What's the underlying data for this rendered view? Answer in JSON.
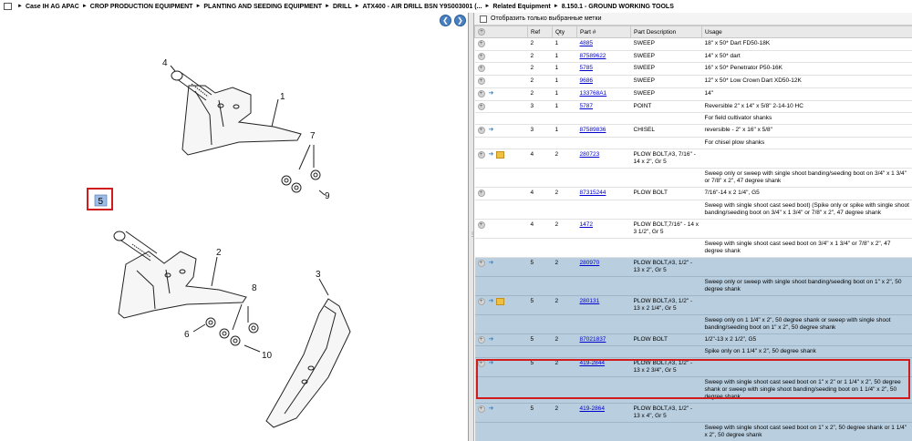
{
  "breadcrumb": [
    "Case IH AG APAC",
    "CROP PRODUCTION EQUIPMENT",
    "PLANTING AND SEEDING EQUIPMENT",
    "DRILL",
    "ATX400 - AIR DRILL BSN Y9S003001 (...",
    "Related Equipment",
    "8.150.1 - GROUND WORKING TOOLS"
  ],
  "filter_label": "Отобразить только выбранные метки",
  "columns": [
    "Ref",
    "Qty",
    "Part #",
    "Part Description",
    "Usage"
  ],
  "callouts": [
    "1",
    "2",
    "3",
    "4",
    "5",
    "6",
    "7",
    "8",
    "9",
    "10"
  ],
  "rows": [
    {
      "ref": "2",
      "qty": "1",
      "part": "4885",
      "desc": "SWEEP",
      "usage": "18\" x 50* Dart FD50-18K",
      "fish": false,
      "note": false,
      "sel": false
    },
    {
      "ref": "2",
      "qty": "1",
      "part": "87589622",
      "desc": "SWEEP",
      "usage": "14\" x 50* dart",
      "fish": false,
      "note": false,
      "sel": false
    },
    {
      "ref": "2",
      "qty": "1",
      "part": "5785",
      "desc": "SWEEP",
      "usage": "16\" x 50* Penetrator P50-16K",
      "fish": false,
      "note": false,
      "sel": false
    },
    {
      "ref": "2",
      "qty": "1",
      "part": "9686",
      "desc": "SWEEP",
      "usage": "12\" x 50* Low Crown Dart XD50-12K",
      "fish": false,
      "note": false,
      "sel": false
    },
    {
      "ref": "2",
      "qty": "1",
      "part": "133768A1",
      "desc": "SWEEP",
      "usage": "14\"",
      "fish": true,
      "note": false,
      "sel": false
    },
    {
      "ref": "3",
      "qty": "1",
      "part": "5787",
      "desc": "POINT",
      "usage": "Reversible 2\" x 14\" x 5/8\" 2-14-10 HC",
      "fish": false,
      "note": false,
      "sel": false
    },
    {
      "ref": "",
      "qty": "",
      "part": "",
      "desc": "",
      "usage": "For field cultivator shanks",
      "fish": false,
      "note": false,
      "sel": false,
      "cont": true
    },
    {
      "ref": "3",
      "qty": "1",
      "part": "87589836",
      "desc": "CHISEL",
      "usage": "reversible - 2\" x 16\" x 5/8\"",
      "fish": true,
      "note": false,
      "sel": false
    },
    {
      "ref": "",
      "qty": "",
      "part": "",
      "desc": "",
      "usage": "For chisel plow shanks",
      "fish": false,
      "note": false,
      "sel": false,
      "cont": true
    },
    {
      "ref": "4",
      "qty": "2",
      "part": "280723",
      "desc": "PLOW BOLT,#3, 7/16\" - 14 x 2\", Gr 5",
      "usage": "",
      "fish": true,
      "note": true,
      "sel": false
    },
    {
      "ref": "",
      "qty": "",
      "part": "",
      "desc": "",
      "usage": "Sweep only or sweep with single shoot banding/seeding boot on 3/4\" x 1 3/4\" or 7/8\" x 2\", 47 degree shank",
      "fish": false,
      "note": false,
      "sel": false,
      "cont": true
    },
    {
      "ref": "4",
      "qty": "2",
      "part": "87315244",
      "desc": "PLOW BOLT",
      "usage": "7/16\"-14 x 2 1/4\", G5",
      "fish": false,
      "note": false,
      "sel": false
    },
    {
      "ref": "",
      "qty": "",
      "part": "",
      "desc": "",
      "usage": "Sweep with single shoot cast seed boot) (Spike only or spike with single shoot banding/seeding boot on 3/4\" x 1 3/4\" or 7/8\" x 2\", 47 degree shank",
      "fish": false,
      "note": false,
      "sel": false,
      "cont": true
    },
    {
      "ref": "4",
      "qty": "2",
      "part": "1472",
      "desc": "PLOW BOLT,7/16\" - 14 x 3 1/2\", Gr 5",
      "usage": "",
      "fish": false,
      "note": false,
      "sel": false
    },
    {
      "ref": "",
      "qty": "",
      "part": "",
      "desc": "",
      "usage": "Sweep with single shoot cast seed boot on 3/4\" x 1 3/4\" or 7/8\" x 2\", 47 degree shank",
      "fish": false,
      "note": false,
      "sel": false,
      "cont": true
    },
    {
      "ref": "5",
      "qty": "2",
      "part": "280970",
      "desc": "PLOW BOLT,#3, 1/2\" - 13 x 2\", Gr 5",
      "usage": "",
      "fish": true,
      "note": false,
      "sel": true
    },
    {
      "ref": "",
      "qty": "",
      "part": "",
      "desc": "",
      "usage": "Sweep only or sweep with single shoot banding/seeding boot on 1\" x 2\", 50 degree shank",
      "fish": false,
      "note": false,
      "sel": true,
      "cont": true
    },
    {
      "ref": "5",
      "qty": "2",
      "part": "280131",
      "desc": "PLOW BOLT,#3, 1/2\" - 13 x 2 1/4\", Gr 5",
      "usage": "",
      "fish": true,
      "note": true,
      "sel": true
    },
    {
      "ref": "",
      "qty": "",
      "part": "",
      "desc": "",
      "usage": "Sweep only on 1 1/4\" x 2\", 50 degree shank or sweep with single shoot banding/seeding boot on 1\" x 2\", 50 degree shank",
      "fish": false,
      "note": false,
      "sel": true,
      "cont": true
    },
    {
      "ref": "5",
      "qty": "2",
      "part": "87021837",
      "desc": "PLOW BOLT",
      "usage": "1/2\"-13 x 2 1/2\", G5",
      "fish": true,
      "note": false,
      "sel": true
    },
    {
      "ref": "",
      "qty": "",
      "part": "",
      "desc": "",
      "usage": "Spike only on 1 1/4\" x 2\", 50 degree shank",
      "fish": false,
      "note": false,
      "sel": true,
      "cont": true
    },
    {
      "ref": "5",
      "qty": "2",
      "part": "419-2844",
      "desc": "PLOW BOLT,#3, 1/2\" - 13 x 2 3/4\", Gr 5",
      "usage": "",
      "fish": true,
      "note": false,
      "sel": true
    },
    {
      "ref": "",
      "qty": "",
      "part": "",
      "desc": "",
      "usage": "Sweep with single shoot cast seed boot on 1\" x 2\" or 1 1/4\" x 2\", 50 degree shank or sweep with single shoot banding/seeding boot on 1 1/4\" x 2\", 50 degree shank",
      "fish": false,
      "note": false,
      "sel": true,
      "cont": true
    },
    {
      "ref": "5",
      "qty": "2",
      "part": "419-2864",
      "desc": "PLOW BOLT,#3, 1/2\" - 13 x 4\", Gr 5",
      "usage": "",
      "fish": true,
      "note": false,
      "sel": true
    },
    {
      "ref": "",
      "qty": "",
      "part": "",
      "desc": "",
      "usage": "Sweep with single shoot cast seed boot on 1\" x 2\", 50 degree shank or 1 1/4\" x 2\", 50 degree shank",
      "fish": false,
      "note": false,
      "sel": true,
      "cont": true
    }
  ]
}
